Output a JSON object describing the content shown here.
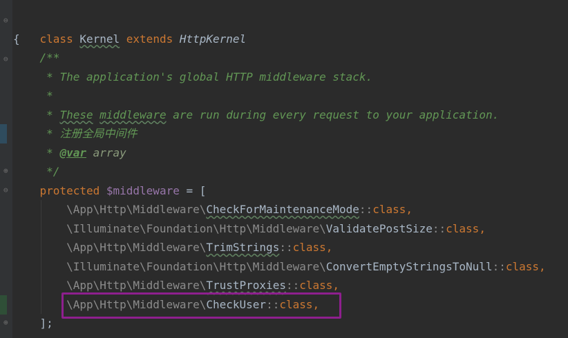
{
  "editor": {
    "lines": [
      {
        "id": "l1",
        "parts": [
          "class",
          "Kernel",
          "extends",
          "HttpKernel"
        ]
      },
      {
        "id": "l2",
        "parts": [
          "{"
        ]
      },
      {
        "id": "l3",
        "parts": [
          "/**"
        ]
      },
      {
        "id": "l4",
        "parts": [
          "* The application's global HTTP middleware stack."
        ]
      },
      {
        "id": "l5",
        "parts": [
          "*"
        ]
      },
      {
        "id": "l6",
        "parts": [
          "* ",
          "These",
          "middleware",
          " are run during every request to your application."
        ]
      },
      {
        "id": "l7",
        "parts": [
          "* 注册全局中间件"
        ]
      },
      {
        "id": "l8",
        "parts": [
          "* ",
          "@var",
          " array"
        ]
      },
      {
        "id": "l9",
        "parts": [
          "*/"
        ]
      },
      {
        "id": "l10",
        "parts": [
          "protected",
          "$middleware",
          "= ["
        ]
      },
      {
        "id": "l11",
        "parts": [
          "\\App\\Http\\Middleware\\",
          "CheckForMaintenanceMode",
          "::",
          "class",
          ","
        ]
      },
      {
        "id": "l12",
        "parts": [
          "\\Illuminate\\Foundation\\Http\\Middleware\\",
          "ValidatePostSize",
          "::",
          "class",
          ","
        ]
      },
      {
        "id": "l13",
        "parts": [
          "\\App\\Http\\Middleware\\",
          "TrimStrings",
          "::",
          "class",
          ","
        ]
      },
      {
        "id": "l14",
        "parts": [
          "\\Illuminate\\Foundation\\Http\\Middleware\\",
          "ConvertEmptyStringsToNull",
          "::",
          "class",
          ","
        ]
      },
      {
        "id": "l15",
        "parts": [
          "\\App\\Http\\Middleware\\",
          "TrustProxies",
          "::",
          "class",
          ","
        ]
      },
      {
        "id": "l16",
        "parts": [
          "\\App\\Http\\Middleware\\",
          "CheckUser",
          "::",
          "class",
          ","
        ]
      },
      {
        "id": "l17",
        "parts": [
          "];"
        ]
      }
    ]
  },
  "colors": {
    "background": "#2b2b2b",
    "keyword": "#cc7832",
    "comment": "#629755",
    "variable": "#9876aa",
    "highlight_box": "#8e1f8e"
  },
  "icons": [
    "fold-marker-icon"
  ]
}
